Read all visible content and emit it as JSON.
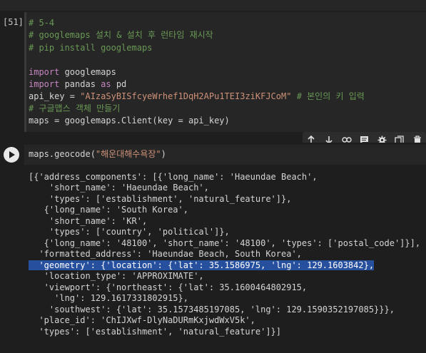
{
  "cell1": {
    "exec_count": "[51]",
    "lines": {
      "l1": "# 5-4",
      "l2": "# googlemaps 설치 & 설치 후 런타임 재시작",
      "l3": "# pip install googlemaps",
      "l5_kw": "import",
      "l5_rest": " googlemaps",
      "l6_kw": "import",
      "l6_mid": " pandas ",
      "l6_kw2": "as",
      "l6_rest": " pd",
      "l7_pre": "api_key = ",
      "l7_str": "\"AIzaSyBISfcyeWrhef1DqH2APu1TEI3ziKFJCoM\"",
      "l7_comment": " # 본인의 키 입력",
      "l8": "# 구글맵스 객체 만들기",
      "l9": "maps = googlemaps.Client(key = api_key)"
    }
  },
  "toolbar": {
    "icons": [
      "arrow-up-icon",
      "arrow-down-icon",
      "link-icon",
      "comment-icon",
      "gear-icon",
      "mirror-cell-icon",
      "trash-icon"
    ]
  },
  "cell2": {
    "code_pre": "maps.geocode(",
    "code_str": "\"해운대해수욕장\"",
    "code_post": ")"
  },
  "output": {
    "o1": "[{'address_components': [{'long_name': 'Haeundae Beach',",
    "o2": "    'short_name': 'Haeundae Beach',",
    "o3": "    'types': ['establishment', 'natural_feature']},",
    "o4": "   {'long_name': 'South Korea',",
    "o5": "    'short_name': 'KR',",
    "o6": "    'types': ['country', 'political']},",
    "o7": "   {'long_name': '48100', 'short_name': '48100', 'types': ['postal_code']}],",
    "o8": "  'formatted_address': 'Haeundae Beach, South Korea',",
    "o9": "  'geometry': {'location': {'lat': 35.1586975, 'lng': 129.1603842},",
    "o10": "   'location_type': 'APPROXIMATE',",
    "o11": "   'viewport': {'northeast': {'lat': 35.1600464802915,",
    "o12": "     'lng': 129.1617331802915},",
    "o13": "    'southwest': {'lat': 35.1573485197085, 'lng': 129.1590352197085}}},",
    "o14": "  'place_id': 'ChIJXwf-DlyNaDURmKxjwdWxV5k',",
    "o15": "  'types': ['establishment', 'natural_feature']}]"
  }
}
